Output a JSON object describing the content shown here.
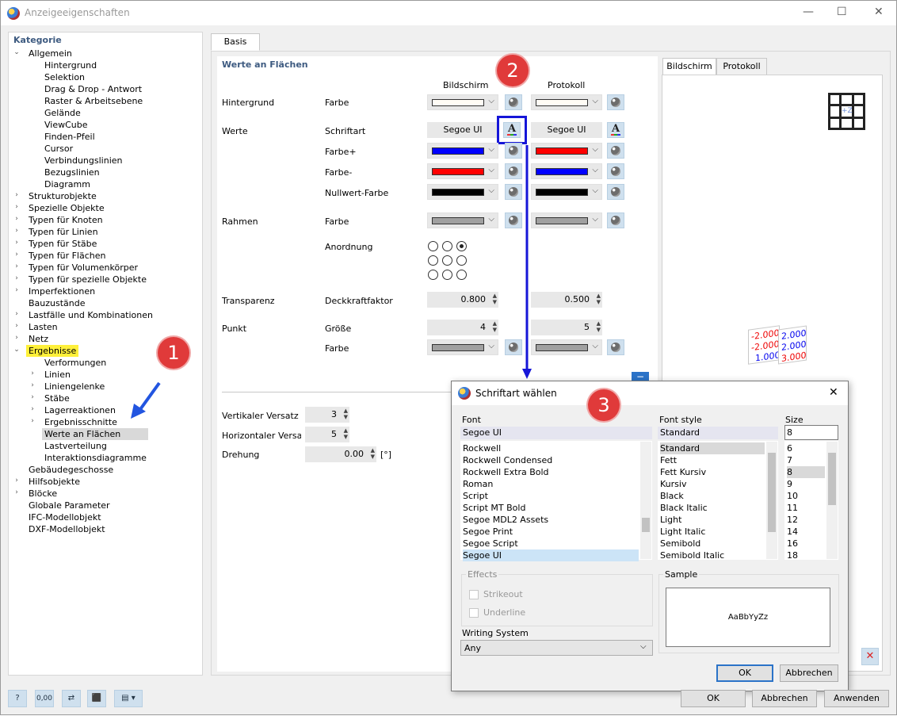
{
  "window": {
    "title": "Anzeigeeigenschaften",
    "min_label": "—",
    "max_label": "☐",
    "close_label": "✕"
  },
  "tree": {
    "header": "Kategorie",
    "items": [
      {
        "label": "Allgemein",
        "level": 0,
        "chev": "open"
      },
      {
        "label": "Hintergrund",
        "level": 2,
        "chev": "none"
      },
      {
        "label": "Selektion",
        "level": 2,
        "chev": "none"
      },
      {
        "label": "Drag & Drop - Antwort",
        "level": 2,
        "chev": "none"
      },
      {
        "label": "Raster & Arbeitsebene",
        "level": 2,
        "chev": "none"
      },
      {
        "label": "Gelände",
        "level": 2,
        "chev": "none"
      },
      {
        "label": "ViewCube",
        "level": 2,
        "chev": "none"
      },
      {
        "label": "Finden-Pfeil",
        "level": 2,
        "chev": "none"
      },
      {
        "label": "Cursor",
        "level": 2,
        "chev": "none"
      },
      {
        "label": "Verbindungslinien",
        "level": 2,
        "chev": "none"
      },
      {
        "label": "Bezugslinien",
        "level": 2,
        "chev": "none"
      },
      {
        "label": "Diagramm",
        "level": 2,
        "chev": "none"
      },
      {
        "label": "Strukturobjekte",
        "level": 0,
        "chev": "closed"
      },
      {
        "label": "Spezielle Objekte",
        "level": 0,
        "chev": "closed"
      },
      {
        "label": "Typen für Knoten",
        "level": 0,
        "chev": "closed"
      },
      {
        "label": "Typen für Linien",
        "level": 0,
        "chev": "closed"
      },
      {
        "label": "Typen für Stäbe",
        "level": 0,
        "chev": "closed"
      },
      {
        "label": "Typen für Flächen",
        "level": 0,
        "chev": "closed"
      },
      {
        "label": "Typen für Volumenkörper",
        "level": 0,
        "chev": "closed"
      },
      {
        "label": "Typen für spezielle Objekte",
        "level": 0,
        "chev": "closed"
      },
      {
        "label": "Imperfektionen",
        "level": 0,
        "chev": "closed"
      },
      {
        "label": "Bauzustände",
        "level": 0,
        "chev": "none"
      },
      {
        "label": "Lastfälle und Kombinationen",
        "level": 0,
        "chev": "closed"
      },
      {
        "label": "Lasten",
        "level": 0,
        "chev": "closed"
      },
      {
        "label": "Netz",
        "level": 0,
        "chev": "closed"
      },
      {
        "label": "Ergebnisse",
        "level": 0,
        "chev": "open",
        "highlight": "yellow"
      },
      {
        "label": "Verformungen",
        "level": 2,
        "chev": "none"
      },
      {
        "label": "Linien",
        "level": 1,
        "chev": "closed"
      },
      {
        "label": "Liniengelenke",
        "level": 1,
        "chev": "closed"
      },
      {
        "label": "Stäbe",
        "level": 1,
        "chev": "closed"
      },
      {
        "label": "Lagerreaktionen",
        "level": 1,
        "chev": "closed"
      },
      {
        "label": "Ergebnisschnitte",
        "level": 1,
        "chev": "closed"
      },
      {
        "label": "Werte an Flächen",
        "level": 2,
        "chev": "none",
        "selected": true
      },
      {
        "label": "Lastverteilung",
        "level": 2,
        "chev": "none"
      },
      {
        "label": "Interaktionsdiagramme",
        "level": 2,
        "chev": "none"
      },
      {
        "label": "Gebäudegeschosse",
        "level": 0,
        "chev": "none"
      },
      {
        "label": "Hilfsobjekte",
        "level": 0,
        "chev": "closed"
      },
      {
        "label": "Blöcke",
        "level": 0,
        "chev": "closed"
      },
      {
        "label": "Globale Parameter",
        "level": 0,
        "chev": "none"
      },
      {
        "label": "IFC-Modellobjekt",
        "level": 0,
        "chev": "none"
      },
      {
        "label": "DXF-Modellobjekt",
        "level": 0,
        "chev": "none"
      }
    ]
  },
  "tabs": {
    "basis": "Basis"
  },
  "section": {
    "title": "Werte an Flächen",
    "col_screen": "Bildschirm",
    "col_print": "Protokoll",
    "rows": {
      "hintergrund": "Hintergrund",
      "werte": "Werte",
      "rahmen": "Rahmen",
      "transparenz": "Transparenz",
      "punkt": "Punkt"
    },
    "props": {
      "farbe": "Farbe",
      "schriftart": "Schriftart",
      "farbe_plus": "Farbe+",
      "farbe_minus": "Farbe-",
      "nullwert": "Nullwert-Farbe",
      "rahmen_farbe": "Farbe",
      "anordnung": "Anordnung",
      "deckkraft": "Deckkraftfaktor",
      "groesse": "Größe",
      "punkt_farbe": "Farbe"
    },
    "font_screen": "Segoe UI",
    "font_print": "Segoe UI",
    "deckkraft_screen": "0.800",
    "deckkraft_print": "0.500",
    "groesse_screen": "4",
    "groesse_print": "5",
    "colors": {
      "bg_screen": "#fffcf5",
      "bg_print": "#fffcf5",
      "plus_screen": "#0000ff",
      "plus_print": "#ff0000",
      "minus_screen": "#ff0000",
      "minus_print": "#0000ff",
      "null_screen": "#000000",
      "null_print": "#000000",
      "frame_screen": "#a0a0a0",
      "frame_print": "#a0a0a0",
      "point_screen": "#a0a0a0",
      "point_print": "#a0a0a0"
    },
    "offset": {
      "vert_label": "Vertikaler Versatz",
      "vert_value": "3",
      "horiz_label": "Horizontaler Versatz",
      "horiz_value": "5",
      "rot_label": "Drehung",
      "rot_value": "0.00",
      "rot_unit": "[°]"
    }
  },
  "preview": {
    "tab_screen": "Bildschirm",
    "tab_print": "Protokoll",
    "cube_label": "+Z",
    "values_left": [
      "-2.000",
      "-2.000",
      "1.000"
    ],
    "values_right": [
      "2.000",
      "2.000",
      "3.000"
    ]
  },
  "badges": {
    "b1": "1",
    "b2": "2",
    "b3": "3"
  },
  "font_dialog": {
    "title": "Schriftart wählen",
    "font_label": "Font",
    "font_value": "Segoe UI",
    "fonts": [
      "Rockwell",
      "Rockwell Condensed",
      "Rockwell Extra Bold",
      "Roman",
      "Script",
      "Script MT Bold",
      "Segoe MDL2 Assets",
      "Segoe Print",
      "Segoe Script",
      "Segoe UI"
    ],
    "style_label": "Font style",
    "style_value": "Standard",
    "styles": [
      "Standard",
      "Fett",
      "Fett Kursiv",
      "Kursiv",
      "Black",
      "Black Italic",
      "Light",
      "Light Italic",
      "Semibold",
      "Semibold Italic"
    ],
    "size_label": "Size",
    "size_value": "8",
    "sizes": [
      "6",
      "7",
      "8",
      "9",
      "10",
      "11",
      "12",
      "14",
      "16",
      "18"
    ],
    "effects_label": "Effects",
    "strikeout": "Strikeout",
    "underline": "Underline",
    "sample_label": "Sample",
    "sample_text": "AaBbYyZz",
    "writing_label": "Writing System",
    "writing_value": "Any",
    "ok": "OK",
    "cancel": "Abbrechen"
  },
  "footer": {
    "ok": "OK",
    "cancel": "Abbrechen",
    "apply": "Anwenden",
    "value_icon": "0,00"
  }
}
